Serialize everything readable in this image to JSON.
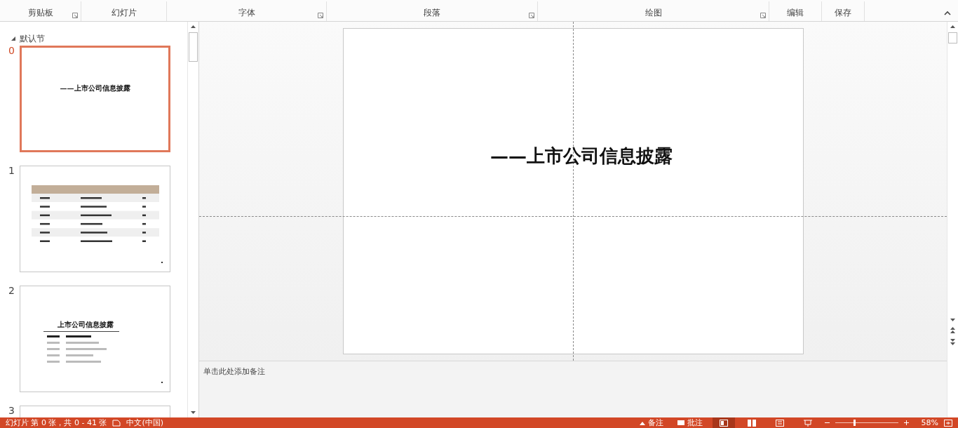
{
  "ribbon": {
    "groups": [
      {
        "label": "剪贴板",
        "launcher": true
      },
      {
        "label": "幻灯片",
        "launcher": false
      },
      {
        "label": "字体",
        "launcher": true
      },
      {
        "label": "段落",
        "launcher": true
      },
      {
        "label": "绘图",
        "launcher": true
      },
      {
        "label": "编辑",
        "launcher": false
      },
      {
        "label": "保存",
        "launcher": false
      }
    ]
  },
  "slide_panel": {
    "section": "默认节",
    "slides": [
      {
        "number": "0",
        "selected": true,
        "kind": "title",
        "title": "——上市公司信息披露"
      },
      {
        "number": "1",
        "selected": false,
        "kind": "table"
      },
      {
        "number": "2",
        "selected": false,
        "kind": "contents",
        "title": "上市公司信息披露"
      },
      {
        "number": "3",
        "selected": false,
        "kind": "cut"
      }
    ]
  },
  "slide": {
    "title": "——上市公司信息披露"
  },
  "notes": {
    "placeholder": "单击此处添加备注"
  },
  "status_bar": {
    "slide_info": "幻灯片 第 0 张，共 0 - 41 张",
    "language": "中文(中国)",
    "notes": "备注",
    "comments": "批注",
    "views": [
      {
        "kind": "normal",
        "selected": true
      },
      {
        "kind": "sorter",
        "selected": false
      },
      {
        "kind": "reading",
        "selected": false
      },
      {
        "kind": "show",
        "selected": false
      }
    ],
    "zoom_slider": {
      "level": 0.3
    },
    "zoom": "58%"
  }
}
